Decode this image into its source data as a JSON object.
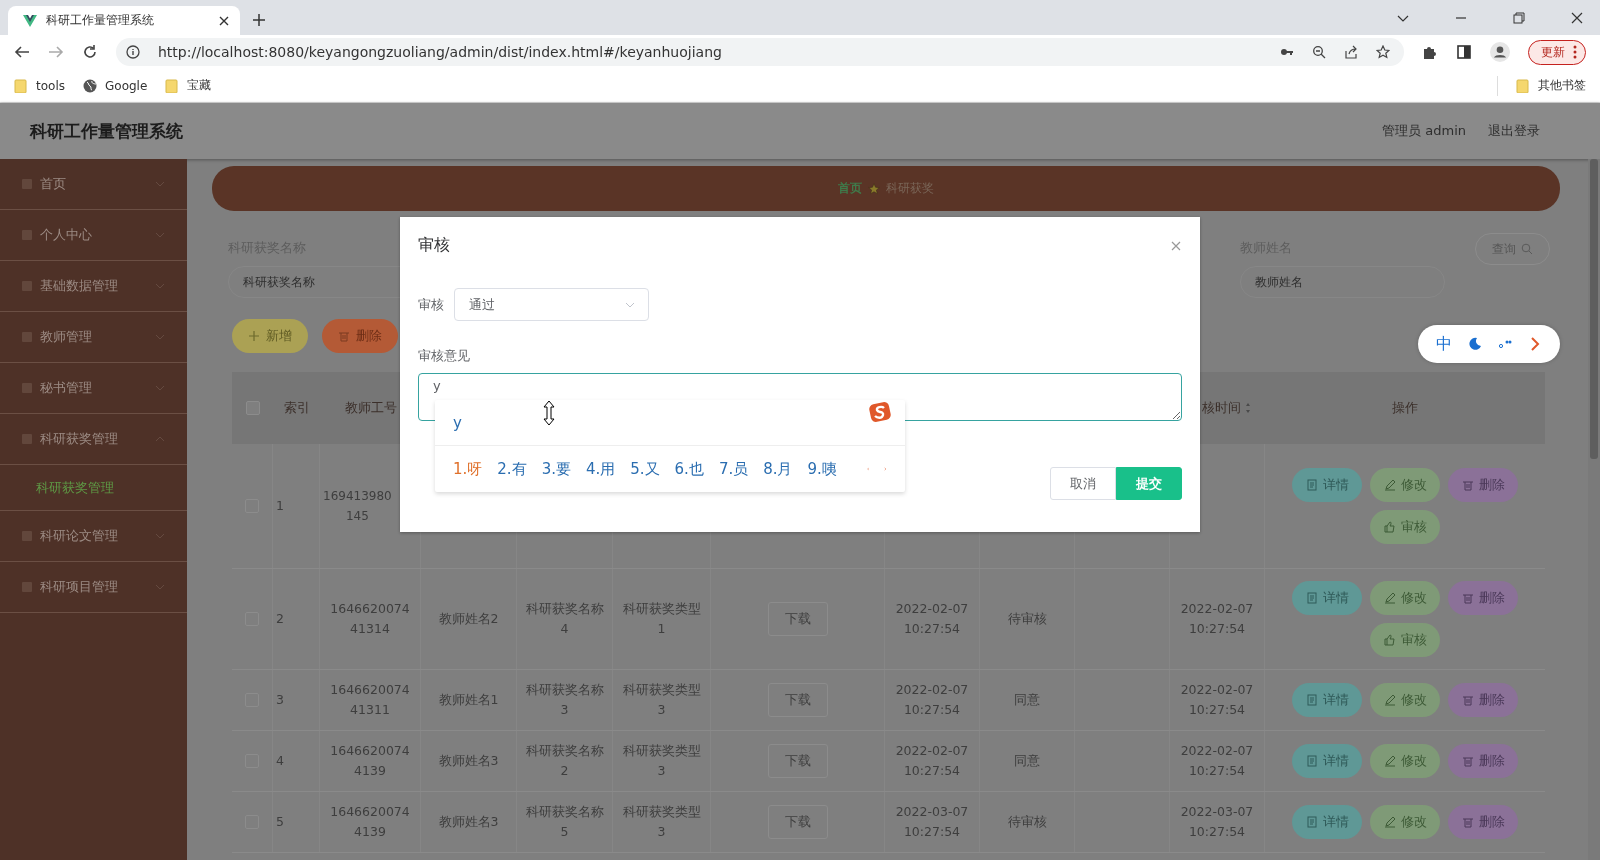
{
  "browser": {
    "tab": {
      "title": "科研工作量管理系统"
    },
    "url": "http://localhost:8080/keyangongzuoliang/admin/dist/index.html#/keyanhuojiang",
    "update_button": "更新",
    "bookmarks": [
      {
        "label": "tools",
        "kind": "folder"
      },
      {
        "label": "Google",
        "kind": "site"
      },
      {
        "label": "宝藏",
        "kind": "folder"
      }
    ],
    "other_bookmarks": "其他书签"
  },
  "header": {
    "title": "科研工作量管理系统",
    "user": "管理员 admin",
    "logout": "退出登录"
  },
  "sidebar": {
    "items": [
      {
        "label": "首页",
        "expanded": false
      },
      {
        "label": "个人中心",
        "expanded": false
      },
      {
        "label": "基础数据管理",
        "expanded": false
      },
      {
        "label": "教师管理",
        "expanded": false
      },
      {
        "label": "秘书管理",
        "expanded": false
      },
      {
        "label": "科研获奖管理",
        "expanded": true,
        "children": [
          {
            "label": "科研获奖管理",
            "selected": true
          }
        ]
      },
      {
        "label": "科研论文管理",
        "expanded": false
      },
      {
        "label": "科研项目管理",
        "expanded": false
      }
    ]
  },
  "breadcrumb": [
    {
      "label": "首页"
    },
    {
      "label": "科研获奖"
    }
  ],
  "search": {
    "fields": [
      {
        "label": "科研获奖名称",
        "placeholder": "科研获奖名称"
      },
      {
        "label": "教师姓名",
        "placeholder": "教师姓名"
      }
    ],
    "button": "查询"
  },
  "toolbar": [
    {
      "label": "新增",
      "kind": "add"
    },
    {
      "label": "删除",
      "kind": "delete"
    }
  ],
  "table": {
    "select_all": {
      "checked": false
    },
    "columns": [
      {
        "label": "索引"
      },
      {
        "label": "教师工号"
      },
      {},
      {},
      {},
      {},
      {},
      {},
      {},
      {
        "label": "核时间",
        "sortable": true
      },
      {
        "label": "操作"
      }
    ],
    "rows": [
      {
        "checked": false,
        "cells": [
          "1",
          "169413980\n145",
          null,
          null,
          null,
          null,
          null,
          null,
          null,
          null
        ],
        "actions": [
          {
            "kind": "detail",
            "label": "详情"
          },
          {
            "kind": "edit",
            "label": "修改"
          },
          {
            "kind": "delete",
            "label": "删除"
          },
          {
            "kind": "review",
            "label": "审核"
          }
        ]
      },
      {
        "checked": false,
        "cells": [
          "2",
          "1646620074\n41314",
          "教师姓名2",
          "科研获奖名称\n4",
          "科研获奖类型\n1",
          {
            "kind": "download",
            "label": "下载"
          },
          "2022-02-07\n10:27:54",
          "待审核",
          null,
          "2022-02-07\n10:27:54"
        ],
        "actions": [
          {
            "kind": "detail",
            "label": "详情"
          },
          {
            "kind": "edit",
            "label": "修改"
          },
          {
            "kind": "delete",
            "label": "删除"
          },
          {
            "kind": "review",
            "label": "审核"
          }
        ]
      },
      {
        "checked": false,
        "cells": [
          "3",
          "1646620074\n41311",
          "教师姓名1",
          "科研获奖名称\n3",
          "科研获奖类型\n3",
          {
            "kind": "download",
            "label": "下载"
          },
          "2022-02-07\n10:27:54",
          "同意",
          null,
          "2022-02-07\n10:27:54"
        ],
        "actions": [
          {
            "kind": "detail",
            "label": "详情"
          },
          {
            "kind": "edit",
            "label": "修改"
          },
          {
            "kind": "delete",
            "label": "删除"
          }
        ]
      },
      {
        "checked": false,
        "cells": [
          "4",
          "1646620074\n4139",
          "教师姓名3",
          "科研获奖名称\n2",
          "科研获奖类型\n3",
          {
            "kind": "download",
            "label": "下载"
          },
          "2022-02-07\n10:27:54",
          "同意",
          null,
          "2022-02-07\n10:27:54"
        ],
        "actions": [
          {
            "kind": "detail",
            "label": "详情"
          },
          {
            "kind": "edit",
            "label": "修改"
          },
          {
            "kind": "delete",
            "label": "删除"
          }
        ]
      },
      {
        "checked": false,
        "cells": [
          "5",
          "1646620074\n4139",
          "教师姓名3",
          "科研获奖名称\n5",
          "科研获奖类型\n3",
          {
            "kind": "download",
            "label": "下载"
          },
          "2022-03-07\n10:27:54",
          "待审核",
          null,
          "2022-03-07\n10:27:54"
        ],
        "actions": [
          {
            "kind": "detail",
            "label": "详情"
          },
          {
            "kind": "edit",
            "label": "修改"
          },
          {
            "kind": "delete",
            "label": "删除"
          }
        ]
      }
    ]
  },
  "dialog": {
    "title": "审核",
    "fields": [
      {
        "label": "审核",
        "kind": "select",
        "value": "通过"
      },
      {
        "label": "审核意见",
        "kind": "textarea",
        "value": "y"
      }
    ],
    "buttons": [
      {
        "label": "取消",
        "kind": "default"
      },
      {
        "label": "提交",
        "kind": "primary"
      }
    ]
  },
  "ime": {
    "composition": "y",
    "candidates": [
      {
        "label": "1.呀",
        "selected": true
      },
      {
        "label": "2.有",
        "selected": false
      },
      {
        "label": "3.要",
        "selected": false
      },
      {
        "label": "4.用",
        "selected": false
      },
      {
        "label": "5.又",
        "selected": false
      },
      {
        "label": "6.也",
        "selected": false
      },
      {
        "label": "7.员",
        "selected": false
      },
      {
        "label": "8.月",
        "selected": false
      },
      {
        "label": "9.咦",
        "selected": false
      }
    ],
    "mode": "中"
  }
}
